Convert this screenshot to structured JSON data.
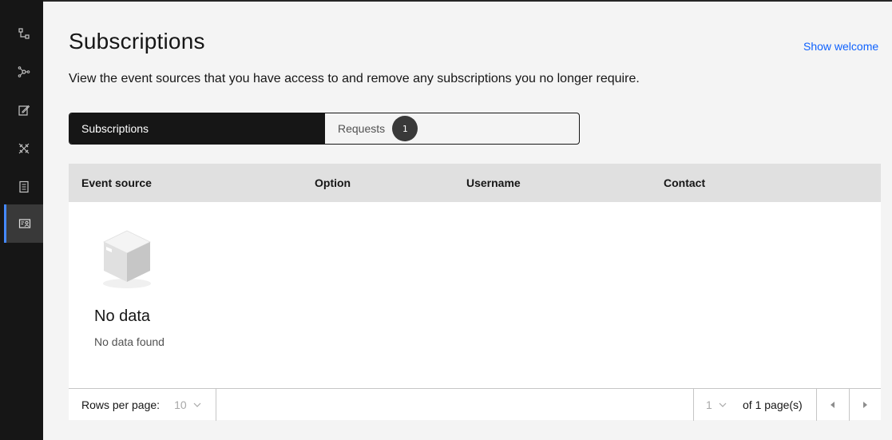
{
  "nav": {
    "items": [
      {
        "icon": "flow-icon"
      },
      {
        "icon": "network-icon"
      },
      {
        "icon": "edit-icon"
      },
      {
        "icon": "unlink-icon"
      },
      {
        "icon": "catalog-icon"
      },
      {
        "icon": "user-card-icon",
        "active": true
      }
    ],
    "accent": "#4589ff"
  },
  "header": {
    "title": "Subscriptions",
    "show_welcome": "Show welcome",
    "description": "View the event sources that you have access to and remove any subscriptions you no longer require."
  },
  "switcher": {
    "tabs": [
      {
        "label": "Subscriptions",
        "selected": true
      },
      {
        "label": "Requests",
        "selected": false,
        "count": "1"
      }
    ]
  },
  "table": {
    "columns": [
      "Event source",
      "Option",
      "Username",
      "Contact"
    ],
    "empty_title": "No data",
    "empty_subtitle": "No data found"
  },
  "pagination": {
    "rows_label": "Rows per page:",
    "rows_value": "10",
    "page_value": "1",
    "page_of": "of 1 page(s)"
  },
  "colors": {
    "link": "#0f62fe",
    "rail": "#161616",
    "selected_tab": "#161616"
  }
}
